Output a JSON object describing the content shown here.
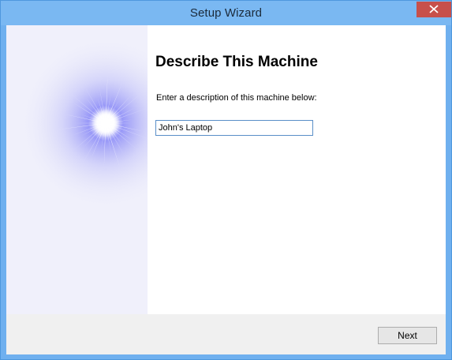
{
  "window": {
    "title": "Setup Wizard",
    "close_icon": "close-icon"
  },
  "side_panel": {
    "decoration": "starburst-graphic"
  },
  "main": {
    "heading": "Describe This Machine",
    "instructions": "Enter a description of this machine below:",
    "description_value": "John's Laptop"
  },
  "footer": {
    "next_label": "Next"
  },
  "colors": {
    "titlebar": "#7ab8f2",
    "close_button": "#c7504b",
    "side_panel": "#f0f0fb",
    "starburst": "#6e6ef5",
    "footer": "#f0f0f0",
    "input_border": "#5a8fc8"
  }
}
